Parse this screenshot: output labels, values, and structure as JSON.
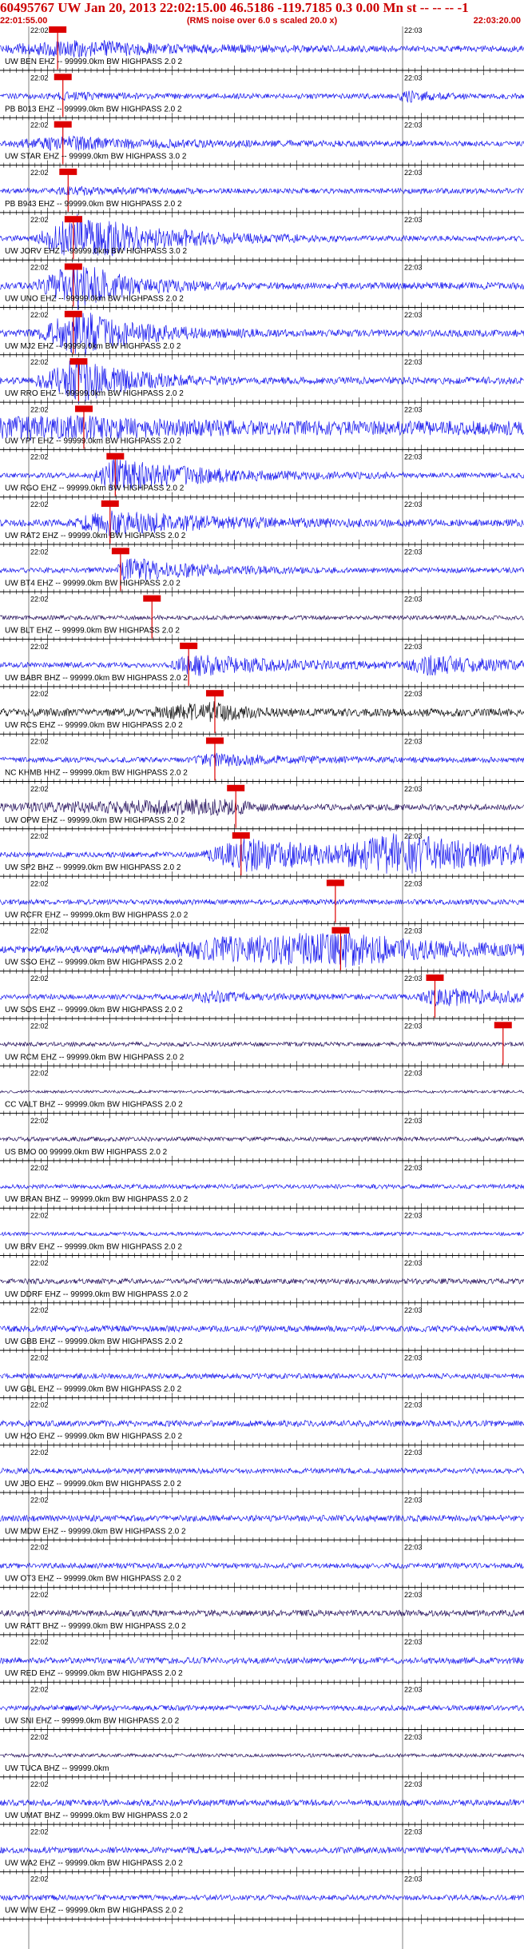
{
  "header": {
    "title": "60495767 UW Jan 20, 2013 22:02:15.00   46.5186 -119.7185  0.3 0.00 Mn st -- -- --  -1",
    "start_time": "22:01:55.00",
    "note": "(RMS noise over 6.0 s scaled 20.0 x)",
    "end_time": "22:03:20.00",
    "tick_label_a": "22:02",
    "tick_label_b": "22:03"
  },
  "colors": {
    "trace": "#1a1aee",
    "trace_dark": "#2a1660",
    "trace_black": "#111111",
    "pick": "#dd0000",
    "axis": "#000000",
    "header": "#cc0000"
  },
  "chart_data": {
    "type": "seismogram",
    "time_range": [
      "22:01:55.00",
      "22:03:20.00"
    ],
    "stations": [
      {
        "label": "UW BEN EHZ -- 99999.0km BW  HIGHPASS  2.0  2",
        "color": "blue",
        "noise": 0.35,
        "pick": 0.11,
        "bursts": [
          [
            0.1,
            0.7,
            0.65,
            0.1
          ],
          [
            0.2,
            0.2,
            0.3,
            0.08
          ]
        ]
      },
      {
        "label": "PB B013 EHZ -- 99999.0km BW  HIGHPASS  2.0  2",
        "color": "blue",
        "noise": 0.3,
        "pick": 0.12,
        "bursts": [
          [
            0.13,
            0.25,
            0.3,
            0.05
          ],
          [
            0.77,
            0.55,
            0.15,
            0.01
          ]
        ]
      },
      {
        "label": "UW STAR EHZ -- 99999.0km BW  HIGHPASS  3.0  2",
        "color": "blue",
        "noise": 0.3,
        "pick": 0.12,
        "bursts": [
          [
            0.12,
            0.6,
            0.7,
            0.12
          ]
        ]
      },
      {
        "label": "PB B943 EHZ -- 99999.0km BW  HIGHPASS  2.0  2",
        "color": "blue",
        "noise": 0.3,
        "pick": 0.13,
        "bursts": [
          [
            0.14,
            0.3,
            0.3,
            0.05
          ]
        ]
      },
      {
        "label": "UW JORV EHZ -- 99999.0km BW  HIGHPASS  3.0  2",
        "color": "blue",
        "noise": 0.3,
        "pick": 0.14,
        "bursts": [
          [
            0.15,
            2.6,
            0.5,
            0.09
          ]
        ]
      },
      {
        "label": "UW UNO EHZ -- 99999.0km BW  HIGHPASS  2.0  2",
        "color": "blue",
        "noise": 0.4,
        "pick": 0.14,
        "bursts": [
          [
            0.15,
            2.4,
            0.3,
            0.09
          ]
        ]
      },
      {
        "label": "UW MJ2 EHZ -- 99999.0km BW  HIGHPASS  2.0  2",
        "color": "blue",
        "noise": 0.4,
        "pick": 0.14,
        "bursts": [
          [
            0.15,
            2.4,
            0.35,
            0.09
          ]
        ]
      },
      {
        "label": "UW RRO EHZ -- 99999.0km BW  HIGHPASS  2.0  2",
        "color": "blue",
        "noise": 0.4,
        "pick": 0.15,
        "bursts": [
          [
            0.15,
            2.4,
            0.3,
            0.09
          ]
        ]
      },
      {
        "label": "UW YPT EHZ -- 99999.0km BW  HIGHPASS  2.0  2",
        "color": "blue",
        "noise": 0.8,
        "pick": 0.16,
        "bursts": [
          [
            0.16,
            0.7,
            0.5,
            0.84
          ]
        ]
      },
      {
        "label": "UW RGO EHZ -- 99999.0km BW  HIGHPASS  2.0  2",
        "color": "blue",
        "noise": 0.3,
        "pick": 0.22,
        "bursts": [
          [
            0.22,
            1.7,
            0.55,
            0.05
          ]
        ]
      },
      {
        "label": "UW RAT2 EHZ -- 99999.0km BW  HIGHPASS  2.0  2",
        "color": "blue",
        "noise": 0.4,
        "pick": 0.21,
        "bursts": [
          [
            0.21,
            1.2,
            0.6,
            0.08
          ]
        ]
      },
      {
        "label": "UW BT4 EHZ -- 99999.0km BW  HIGHPASS  2.0  2",
        "color": "blue",
        "noise": 0.3,
        "pick": 0.23,
        "bursts": [
          [
            0.24,
            1.3,
            0.4,
            0.02
          ]
        ]
      },
      {
        "label": "UW BLT EHZ -- 99999.0km BW  HIGHPASS  2.0  2",
        "color": "dark",
        "noise": 0.25,
        "pick": 0.29,
        "bursts": []
      },
      {
        "label": "UW BABR BHZ -- 99999.0km BW  HIGHPASS  2.0  2",
        "color": "blue",
        "noise": 0.3,
        "pick": 0.36,
        "bursts": [
          [
            0.37,
            1.1,
            0.55,
            0.05
          ],
          [
            0.82,
            0.9,
            0.45,
            0.05
          ]
        ]
      },
      {
        "label": "UW RCS EHZ -- 99999.0km BW  HIGHPASS  2.0  2",
        "color": "black",
        "noise": 0.45,
        "pick": 0.41,
        "bursts": [
          [
            0.41,
            0.9,
            0.15,
            0.15
          ]
        ]
      },
      {
        "label": "NC KHMB HHZ -- 99999.0km BW  HIGHPASS  2.0  2",
        "color": "blue",
        "noise": 0.3,
        "pick": 0.41,
        "bursts": [
          [
            0.41,
            0.6,
            0.4,
            0.05
          ]
        ]
      },
      {
        "label": "UW OPW EHZ -- 99999.0km BW  HIGHPASS  2.0  2",
        "color": "dark",
        "noise": 0.35,
        "pick": 0.45,
        "bursts": [
          [
            0.45,
            0.7,
            0.1,
            0.55
          ]
        ]
      },
      {
        "label": "UW SP2 BHZ -- 99999.0km BW  HIGHPASS  2.0  2",
        "color": "blue",
        "noise": 0.3,
        "pick": 0.46,
        "bursts": [
          [
            0.47,
            1.8,
            0.7,
            0.09
          ],
          [
            0.76,
            1.8,
            0.75,
            0.12
          ]
        ]
      },
      {
        "label": "UW RCFR EHZ -- 99999.0km BW  HIGHPASS  2.0  2",
        "color": "blue",
        "noise": 0.3,
        "pick": 0.64,
        "bursts": []
      },
      {
        "label": "UW SSO EHZ -- 99999.0km BW  HIGHPASS  2.0  2",
        "color": "blue",
        "noise": 0.4,
        "pick": 0.65,
        "bursts": [
          [
            0.43,
            0.6,
            0.5,
            0.22
          ],
          [
            0.65,
            1.6,
            0.65,
            0.33
          ]
        ]
      },
      {
        "label": "UW SOS EHZ -- 99999.0km BW  HIGHPASS  2.0  2",
        "color": "blue",
        "noise": 0.3,
        "pick": 0.83,
        "bursts": [
          [
            0.39,
            0.5,
            0.3,
            0.05
          ],
          [
            0.84,
            0.9,
            0.5,
            0.05
          ]
        ]
      },
      {
        "label": "UW RCM EHZ -- 99999.0km BW  HIGHPASS  2.0  2",
        "color": "dark",
        "noise": 0.25,
        "pick": 0.96,
        "bursts": []
      },
      {
        "label": "CC VALT BHZ -- 99999.0km BW  HIGHPASS  2.0  2",
        "color": "dark",
        "noise": 0.15,
        "pick": null,
        "bursts": []
      },
      {
        "label": "US BMO 00 99999.0km BW  HIGHPASS  2.0  2",
        "color": "dark",
        "noise": 0.25,
        "pick": null,
        "bursts": []
      },
      {
        "label": "UW BRAN BHZ -- 99999.0km BW  HIGHPASS  2.0  2",
        "color": "blue",
        "noise": 0.25,
        "pick": null,
        "bursts": []
      },
      {
        "label": "UW BRV EHZ -- 99999.0km BW  HIGHPASS  2.0  2",
        "color": "blue",
        "noise": 0.2,
        "pick": null,
        "bursts": []
      },
      {
        "label": "UW DDRF EHZ -- 99999.0km BW  HIGHPASS  2.0  2",
        "color": "dark",
        "noise": 0.3,
        "pick": null,
        "bursts": []
      },
      {
        "label": "UW GBB EHZ -- 99999.0km BW  HIGHPASS  2.0  2",
        "color": "blue",
        "noise": 0.35,
        "pick": null,
        "bursts": []
      },
      {
        "label": "UW GBL EHZ -- 99999.0km BW  HIGHPASS  2.0  2",
        "color": "blue",
        "noise": 0.3,
        "pick": null,
        "bursts": []
      },
      {
        "label": "UW H2O EHZ -- 99999.0km BW  HIGHPASS  2.0  2",
        "color": "blue",
        "noise": 0.35,
        "pick": null,
        "bursts": []
      },
      {
        "label": "UW JBO EHZ -- 99999.0km BW  HIGHPASS  2.0  2",
        "color": "blue",
        "noise": 0.3,
        "pick": null,
        "bursts": []
      },
      {
        "label": "UW MDW EHZ -- 99999.0km BW  HIGHPASS  2.0  2",
        "color": "blue",
        "noise": 0.35,
        "pick": null,
        "bursts": []
      },
      {
        "label": "UW OT3 EHZ -- 99999.0km BW  HIGHPASS  2.0  2",
        "color": "blue",
        "noise": 0.3,
        "pick": null,
        "bursts": []
      },
      {
        "label": "UW RATT BHZ -- 99999.0km BW  HIGHPASS  2.0  2",
        "color": "dark",
        "noise": 0.35,
        "pick": null,
        "bursts": []
      },
      {
        "label": "UW RED EHZ -- 99999.0km BW  HIGHPASS  2.0  2",
        "color": "blue",
        "noise": 0.35,
        "pick": null,
        "bursts": []
      },
      {
        "label": "UW SNI EHZ -- 99999.0km BW  HIGHPASS  2.0  2",
        "color": "blue",
        "noise": 0.3,
        "pick": null,
        "bursts": []
      },
      {
        "label": "UW TUCA BHZ -- 99999.0km",
        "color": "dark",
        "noise": 0.2,
        "pick": null,
        "bursts": []
      },
      {
        "label": "UW UMAT BHZ -- 99999.0km BW  HIGHPASS  2.0  2",
        "color": "blue",
        "noise": 0.35,
        "pick": null,
        "bursts": []
      },
      {
        "label": "UW WA2 EHZ -- 99999.0km BW  HIGHPASS  2.0  2",
        "color": "blue",
        "noise": 0.35,
        "pick": null,
        "bursts": []
      },
      {
        "label": "UW WIW EHZ -- 99999.0km BW  HIGHPASS  2.0  2",
        "color": "blue",
        "noise": 0.3,
        "pick": null,
        "bursts": []
      }
    ]
  }
}
